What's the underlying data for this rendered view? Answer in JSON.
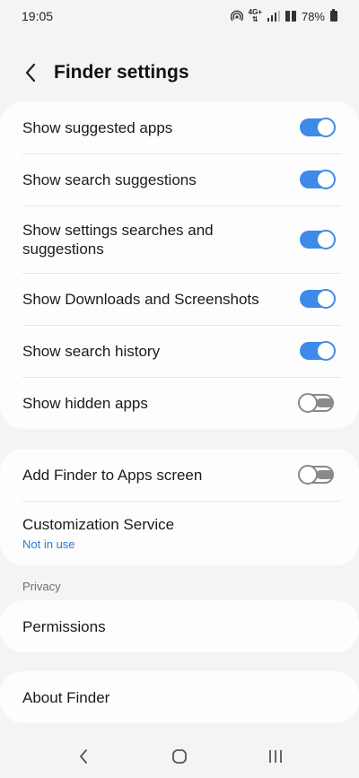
{
  "status_bar": {
    "time": "19:05",
    "network_top": "4G+",
    "network_bottom": "⇅",
    "battery": "78%",
    "icons": [
      "hotspot-icon",
      "wifi-calling-icon",
      "signal-icon",
      "battery-icon"
    ]
  },
  "header": {
    "back_icon": "chevron-left-icon",
    "title": "Finder settings"
  },
  "main_card": {
    "items": [
      {
        "label": "Show suggested apps",
        "toggle": true
      },
      {
        "label": "Show search suggestions",
        "toggle": true
      },
      {
        "label": "Show settings searches and suggestions",
        "toggle": true
      },
      {
        "label": "Show Downloads and Screenshots",
        "toggle": true
      },
      {
        "label": "Show search history",
        "toggle": true
      },
      {
        "label": "Show hidden apps",
        "toggle": false
      }
    ]
  },
  "second_card": {
    "add_finder_label": "Add Finder to Apps screen",
    "add_finder_toggle": false,
    "customization_label": "Customization Service",
    "customization_sub": "Not in use"
  },
  "privacy": {
    "section_label": "Privacy",
    "permissions_label": "Permissions"
  },
  "about": {
    "label": "About Finder"
  },
  "colors": {
    "accent": "#3e8ae8",
    "link": "#2a7ad0",
    "background": "#f4f4f4",
    "card": "#fdfdfd"
  },
  "nav_bar": {
    "icons": [
      "back-nav-icon",
      "home-nav-icon",
      "recents-nav-icon"
    ]
  }
}
